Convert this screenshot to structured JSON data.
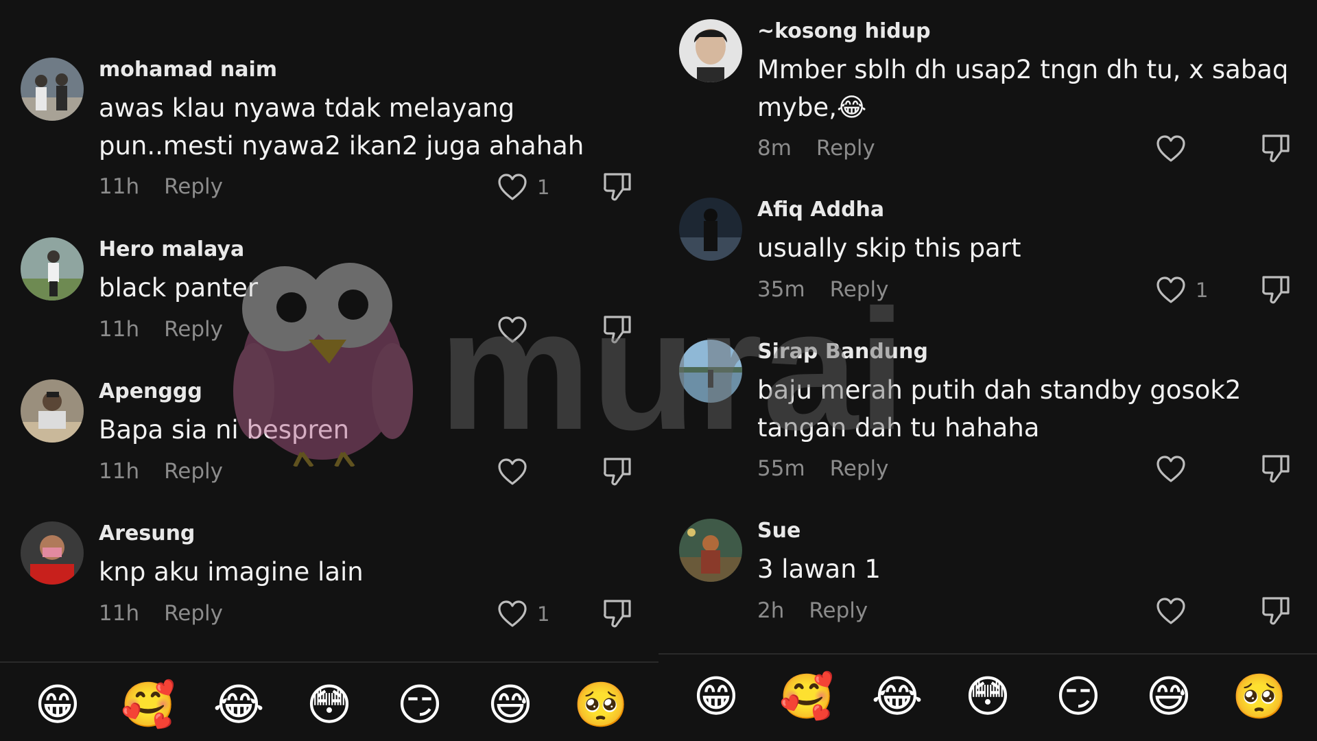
{
  "left": {
    "comments": [
      {
        "user": "mohamad naim",
        "text": "awas klau nyawa tdak melayang pun..mesti nyawa2 ikan2 juga ahahah",
        "time": "11h",
        "reply": "Reply",
        "likes": "1"
      },
      {
        "user": "Hero malaya",
        "text": "black panter",
        "time": "11h",
        "reply": "Reply",
        "likes": ""
      },
      {
        "user": "Apenggg",
        "text": "Bapa sia ni bespren",
        "time": "11h",
        "reply": "Reply",
        "likes": ""
      },
      {
        "user": "Aresung",
        "text": "knp aku imagine lain",
        "time": "11h",
        "reply": "Reply",
        "likes": "1"
      }
    ],
    "emojis": [
      "😁",
      "🥰",
      "😂",
      "😳",
      "😏",
      "😅",
      "🥺"
    ]
  },
  "right": {
    "comments": [
      {
        "user": "~kosong hidup",
        "text": "Mmber sblh dh usap2 tngn dh tu, x sabaq mybe,😂",
        "time": "8m",
        "reply": "Reply",
        "likes": ""
      },
      {
        "user": "Afiq Addha",
        "text": "usually skip this part",
        "time": "35m",
        "reply": "Reply",
        "likes": "1"
      },
      {
        "user": "Sirap Bandung",
        "text": "baju merah putih dah standby gosok2 tangan dah tu hahaha",
        "time": "55m",
        "reply": "Reply",
        "likes": ""
      },
      {
        "user": "Sue",
        "text": "3 lawan 1",
        "time": "2h",
        "reply": "Reply",
        "likes": ""
      }
    ],
    "emojis": [
      "😁",
      "🥰",
      "😂",
      "😳",
      "😏",
      "😅",
      "🥺"
    ]
  },
  "watermark": {
    "text": "murai"
  },
  "icons": {
    "like": "heart-outline-icon",
    "dislike": "thumbs-down-outline-icon"
  },
  "colors": {
    "background": "#121212",
    "secondary_text": "#8c8c8c",
    "watermark_bird": "#a0507a"
  }
}
